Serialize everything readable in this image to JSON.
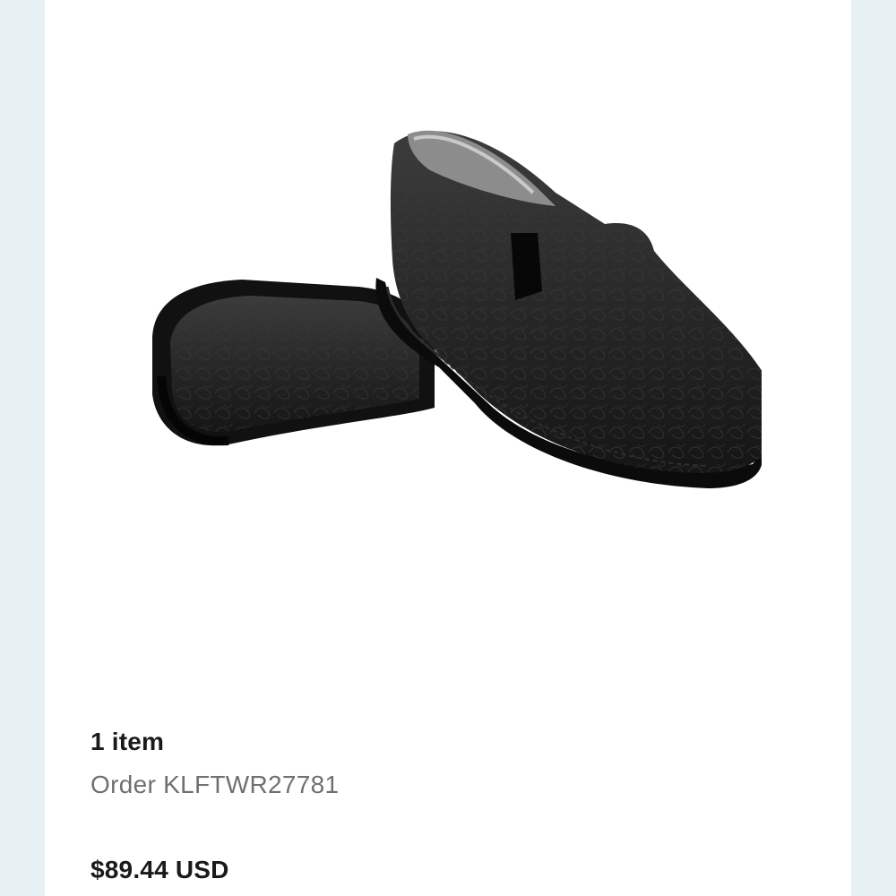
{
  "order_summary": {
    "item_count_label": "1 item",
    "order_number_label": "Order KLFTWR27781",
    "total_label": "$89.44 USD"
  },
  "product": {
    "image_icon": "black-tooled-leather-clog-shoes-image"
  },
  "colors": {
    "background_side": "#e7f0f3",
    "card_background": "#ffffff",
    "primary_text": "#1a1a1a",
    "secondary_text": "#707070"
  }
}
